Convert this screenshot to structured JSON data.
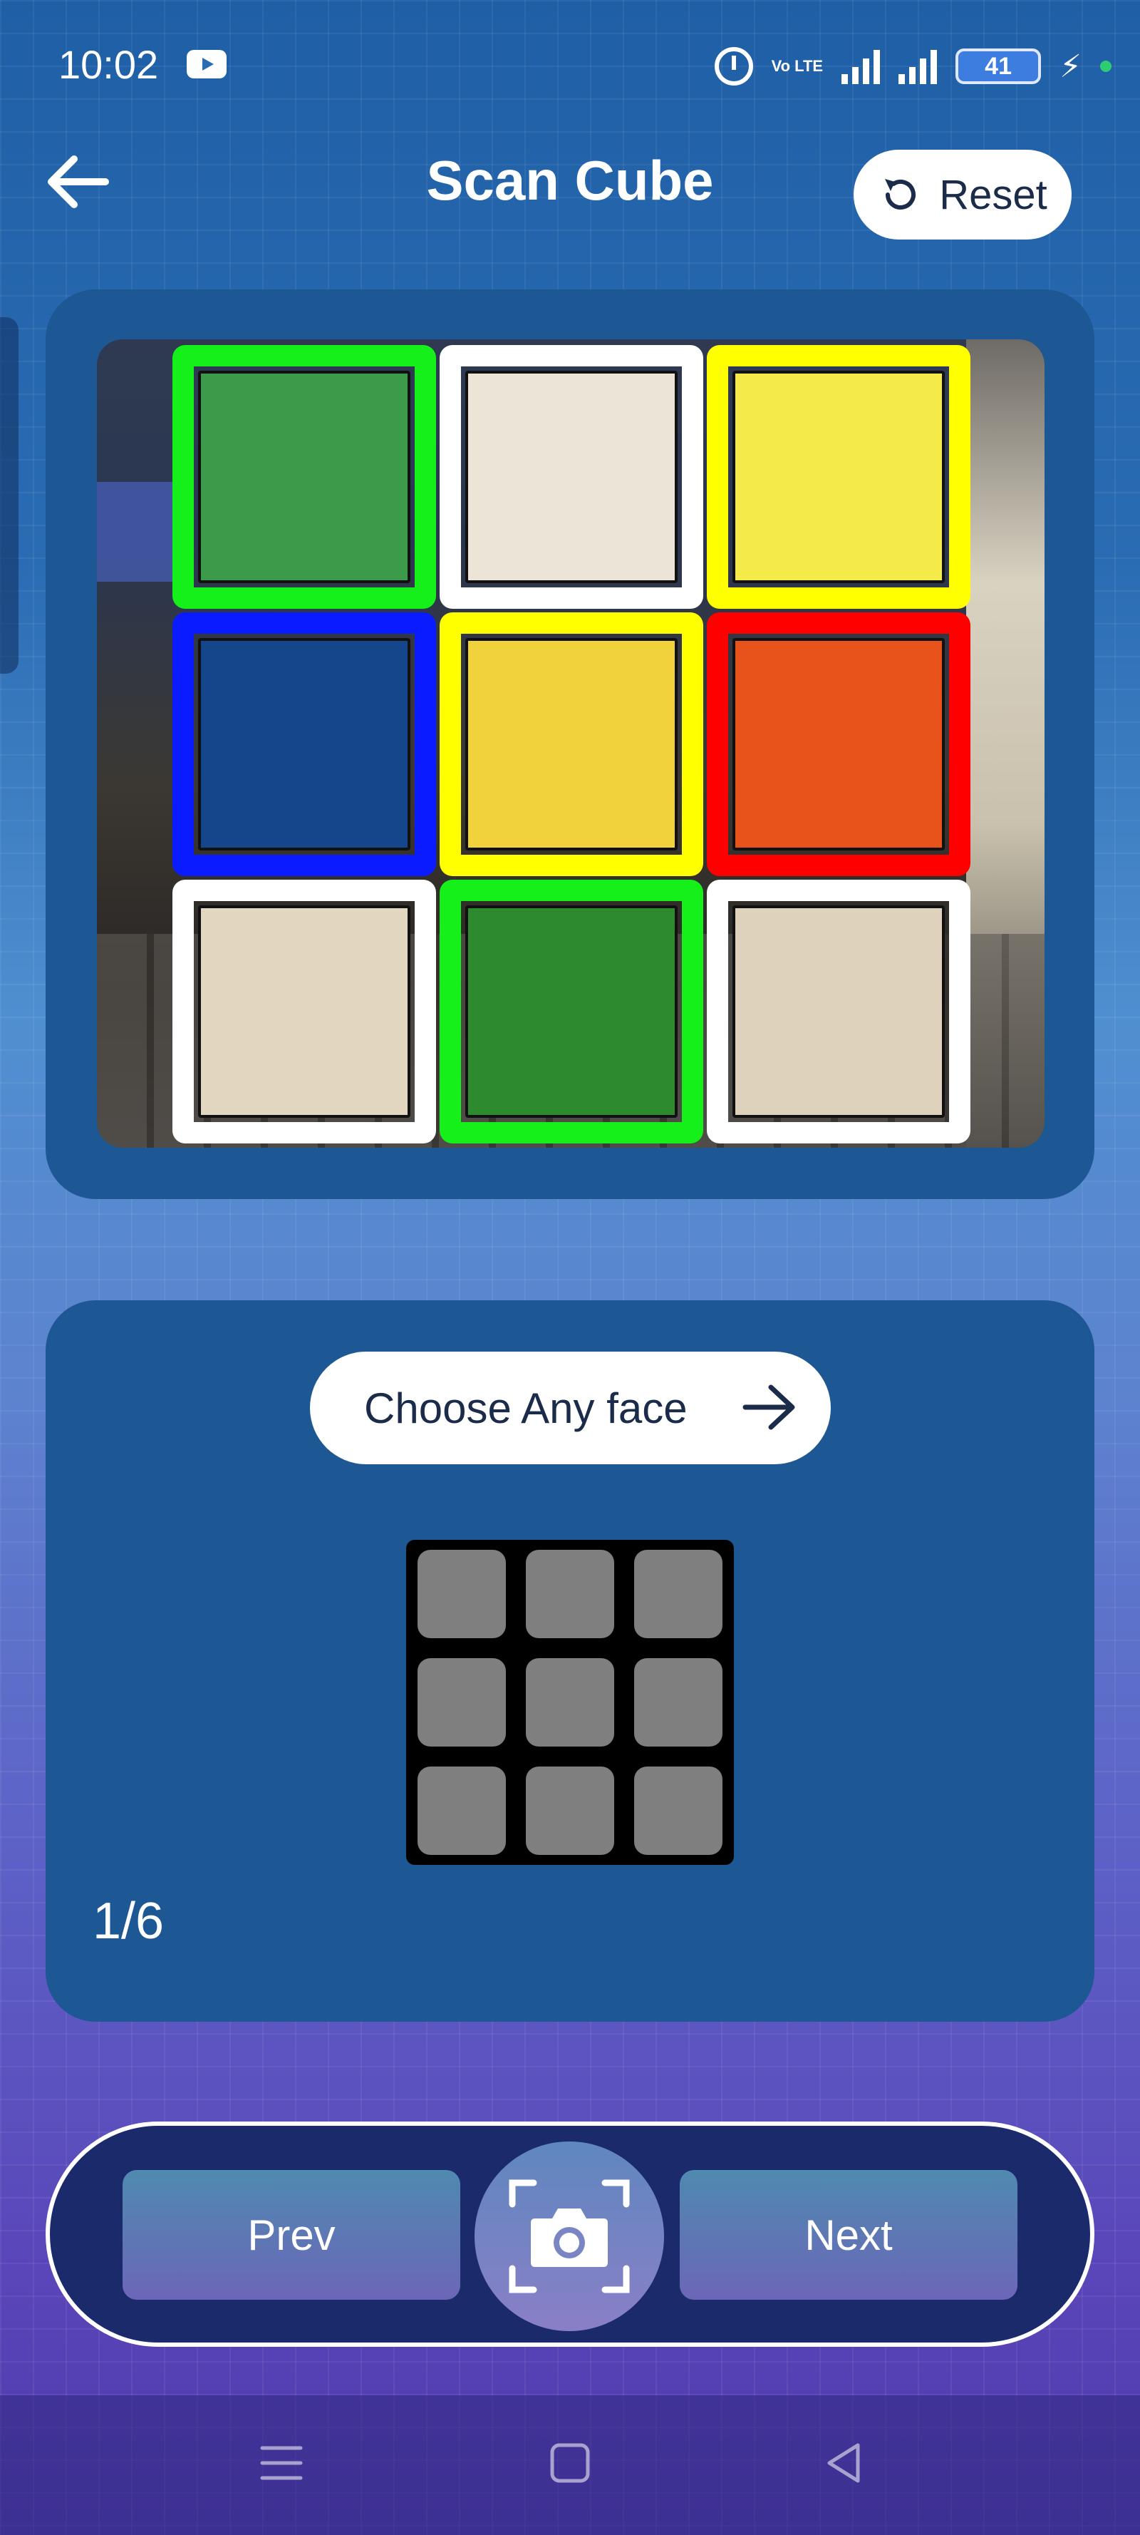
{
  "status_bar": {
    "time": "10:02",
    "volte": "Vo LTE",
    "battery": "41"
  },
  "header": {
    "title": "Scan Cube",
    "reset_label": "Reset"
  },
  "scanner": {
    "stickers": [
      {
        "position": "top-left",
        "border": "#16f01a",
        "face": "#3c9a4b"
      },
      {
        "position": "top-center",
        "border": "#ffffff",
        "face": "#ece4d6"
      },
      {
        "position": "top-right",
        "border": "#ffff00",
        "face": "#f4ea4a"
      },
      {
        "position": "middle-left",
        "border": "#0a1cff",
        "face": "#15468c"
      },
      {
        "position": "center",
        "border": "#ffff00",
        "face": "#f2d23c"
      },
      {
        "position": "middle-right",
        "border": "#ff0000",
        "face": "#e8521b"
      },
      {
        "position": "bottom-left",
        "border": "#ffffff",
        "face": "#e2d6c1"
      },
      {
        "position": "bottom-center",
        "border": "#16f01a",
        "face": "#2d8a2f"
      },
      {
        "position": "bottom-right",
        "border": "#ffffff",
        "face": "#dfd2bc"
      }
    ]
  },
  "face_selector": {
    "choose_label": "Choose Any face",
    "counter": "1/6",
    "preview_color": "#7f7f7f"
  },
  "controls": {
    "prev_label": "Prev",
    "next_label": "Next"
  },
  "colors": {
    "card": "#1e5894",
    "control_bar": "#1b2a6b",
    "text_dark": "#1b2b4a"
  }
}
